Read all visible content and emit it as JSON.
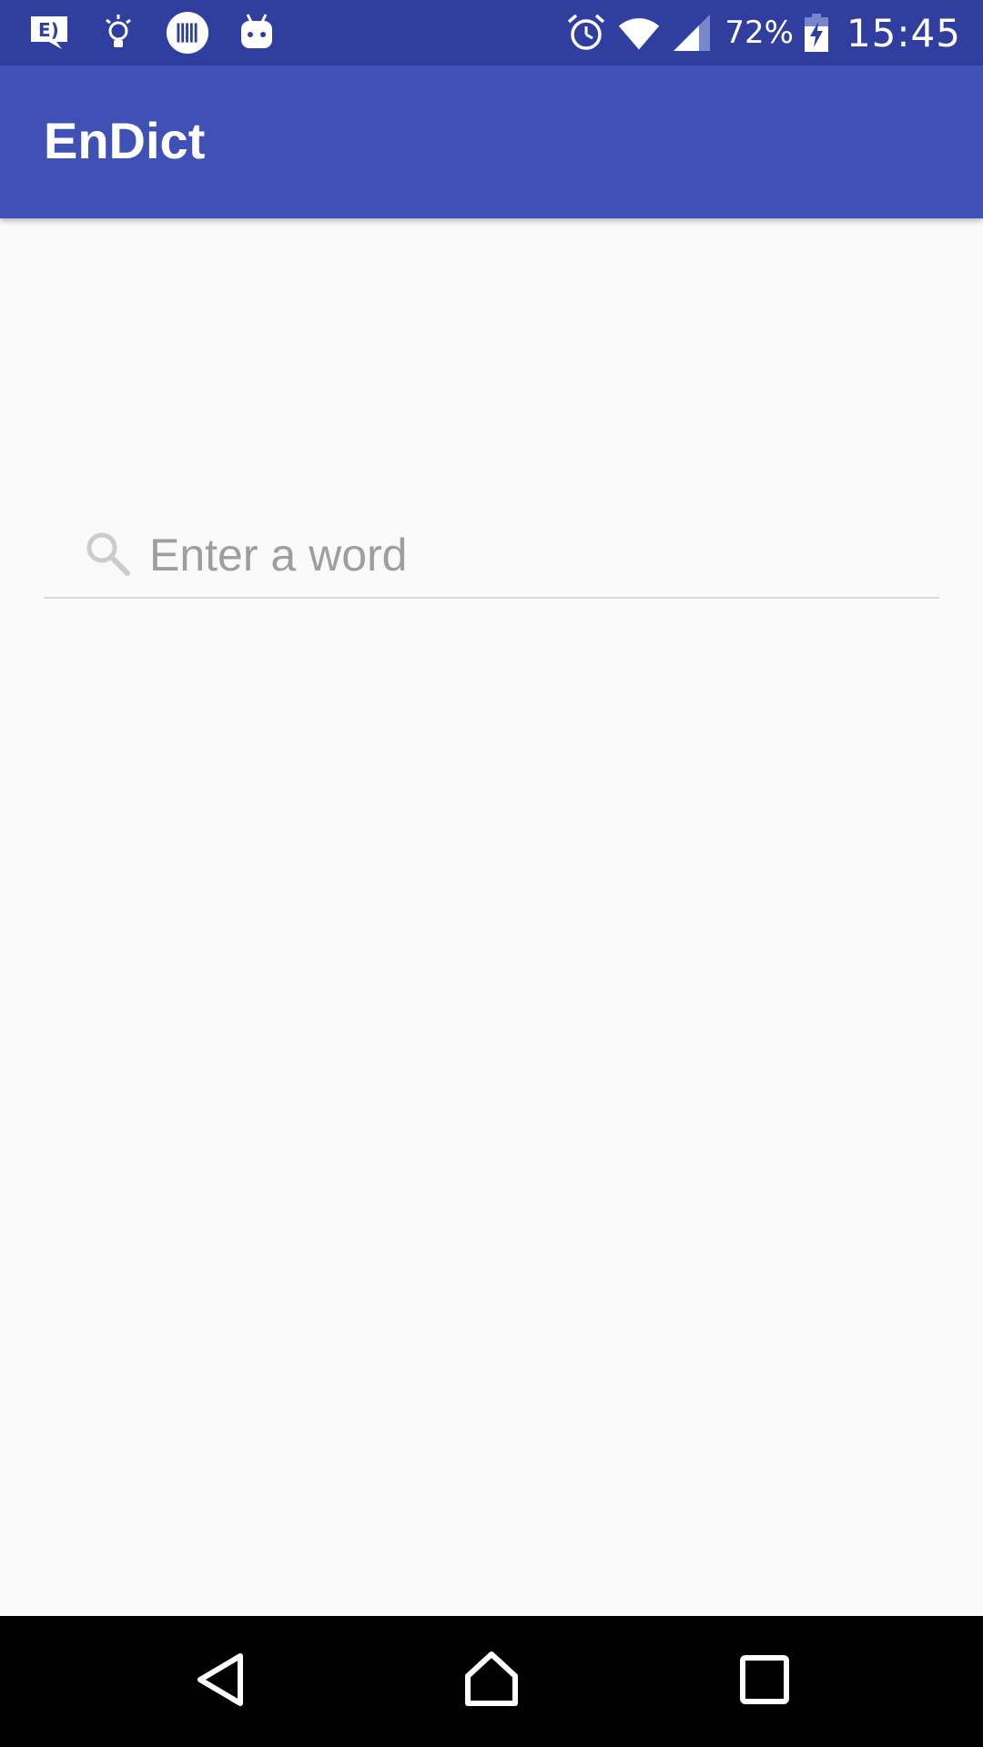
{
  "status_bar": {
    "battery_percent": "72%",
    "time": "15:45",
    "icons_left": [
      "notification-chat-icon",
      "lightbulb-icon",
      "barcode-icon",
      "android-icon"
    ],
    "icons_right": [
      "alarm-icon",
      "wifi-icon",
      "cellular-signal-icon",
      "battery-charging-icon"
    ]
  },
  "app_bar": {
    "title": "EnDict"
  },
  "search": {
    "placeholder": "Enter a word",
    "value": "",
    "icon": "search-icon"
  },
  "nav_bar": {
    "buttons": [
      "back-icon",
      "home-icon",
      "recents-icon"
    ]
  },
  "colors": {
    "status_bar": "#303f9f",
    "app_bar": "#3f51b5",
    "background": "#fafafa",
    "placeholder": "#9e9e9e",
    "nav_bar": "#000000"
  }
}
